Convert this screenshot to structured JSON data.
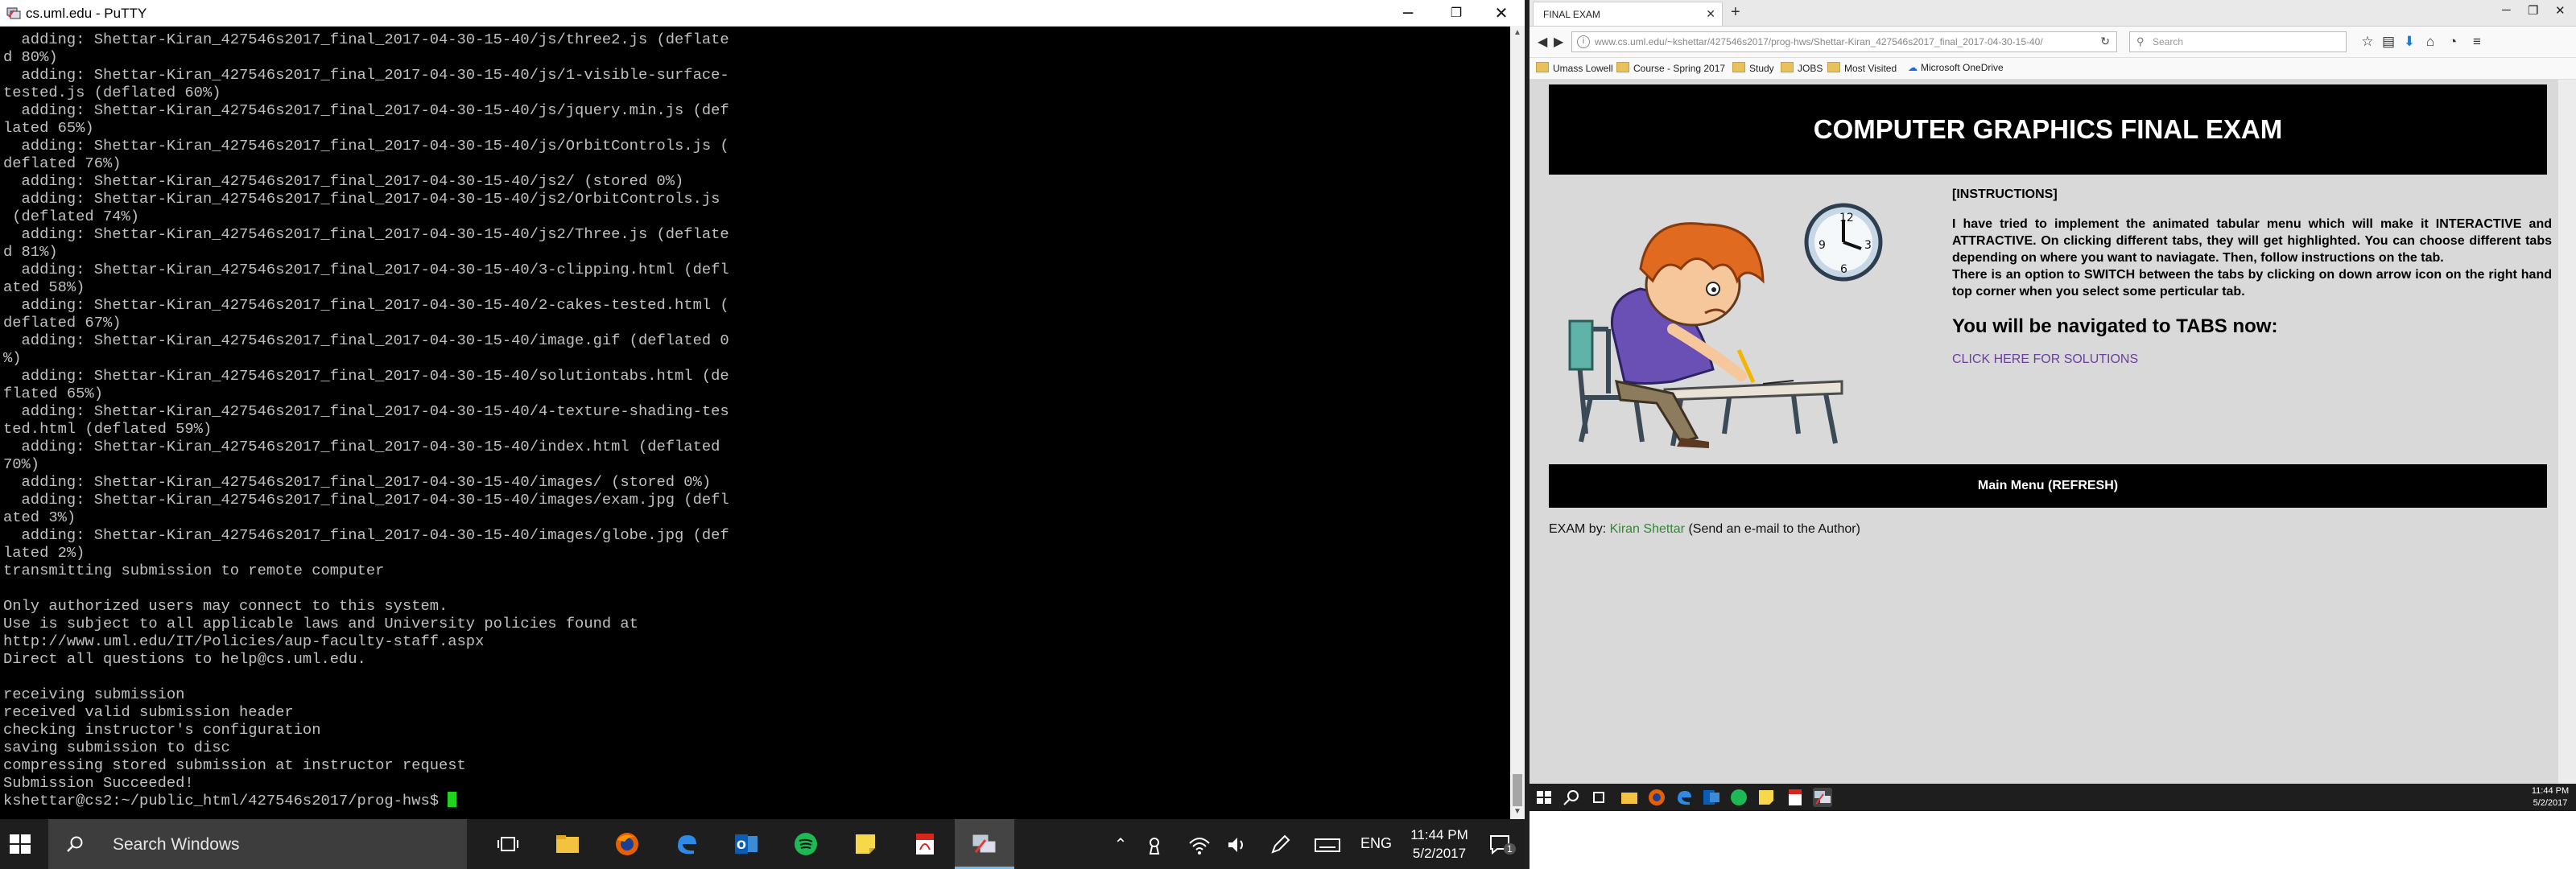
{
  "putty": {
    "title": "cs.uml.edu - PuTTY",
    "controls": {
      "minimize": "─",
      "restore": "❐",
      "close": "✕"
    },
    "terminal_lines": [
      "  adding: Shettar-Kiran_427546s2017_final_2017-04-30-15-40/js/three2.js (deflate",
      "d 80%)",
      "  adding: Shettar-Kiran_427546s2017_final_2017-04-30-15-40/js/1-visible-surface-",
      "tested.js (deflated 60%)",
      "  adding: Shettar-Kiran_427546s2017_final_2017-04-30-15-40/js/jquery.min.js (def",
      "lated 65%)",
      "  adding: Shettar-Kiran_427546s2017_final_2017-04-30-15-40/js/OrbitControls.js (",
      "deflated 76%)",
      "  adding: Shettar-Kiran_427546s2017_final_2017-04-30-15-40/js2/ (stored 0%)",
      "  adding: Shettar-Kiran_427546s2017_final_2017-04-30-15-40/js2/OrbitControls.js",
      " (deflated 74%)",
      "  adding: Shettar-Kiran_427546s2017_final_2017-04-30-15-40/js2/Three.js (deflate",
      "d 81%)",
      "  adding: Shettar-Kiran_427546s2017_final_2017-04-30-15-40/3-clipping.html (defl",
      "ated 58%)",
      "  adding: Shettar-Kiran_427546s2017_final_2017-04-30-15-40/2-cakes-tested.html (",
      "deflated 67%)",
      "  adding: Shettar-Kiran_427546s2017_final_2017-04-30-15-40/image.gif (deflated 0",
      "%)",
      "  adding: Shettar-Kiran_427546s2017_final_2017-04-30-15-40/solutiontabs.html (de",
      "flated 65%)",
      "  adding: Shettar-Kiran_427546s2017_final_2017-04-30-15-40/4-texture-shading-tes",
      "ted.html (deflated 59%)",
      "  adding: Shettar-Kiran_427546s2017_final_2017-04-30-15-40/index.html (deflated",
      "70%)",
      "  adding: Shettar-Kiran_427546s2017_final_2017-04-30-15-40/images/ (stored 0%)",
      "  adding: Shettar-Kiran_427546s2017_final_2017-04-30-15-40/images/exam.jpg (defl",
      "ated 3%)",
      "  adding: Shettar-Kiran_427546s2017_final_2017-04-30-15-40/images/globe.jpg (def",
      "lated 2%)",
      "transmitting submission to remote computer",
      "",
      "Only authorized users may connect to this system.",
      "Use is subject to all applicable laws and University policies found at",
      "http://www.uml.edu/IT/Policies/aup-faculty-staff.aspx",
      "Direct all questions to help@cs.uml.edu.",
      "",
      "receiving submission",
      "received valid submission header",
      "checking instructor's configuration",
      "saving submission to disc",
      "compressing stored submission at instructor request",
      "Submission Succeeded!"
    ],
    "prompt": "kshettar@cs2:~/public_html/427546s2017/prog-hws$ "
  },
  "taskbar_left": {
    "search_placeholder": "Search Windows",
    "language": "ENG",
    "time": "11:44 PM",
    "date": "5/2/2017",
    "notification_count": "1"
  },
  "firefox": {
    "tab_title": "FINAL EXAM",
    "url": "www.cs.uml.edu/~kshettar/427546s2017/prog-hws/Shettar-Kiran_427546s2017_final_2017-04-30-15-40/",
    "search_placeholder": "Search",
    "bookmarks": [
      "Umass Lowell",
      "Course - Spring 2017",
      "Study",
      "JOBS",
      "Most Visited",
      "Microsoft OneDrive"
    ]
  },
  "page": {
    "header": "COMPUTER GRAPHICS FINAL EXAM",
    "instructions_heading": "[INSTRUCTIONS]",
    "instructions_p1": "I have tried to implement the animated tabular menu which will make it INTERACTIVE and ATTRACTIVE. On clicking different tabs, they will get highlighted. You can choose different tabs depending on where you want to naviagate. Then, follow instructions on the tab.",
    "instructions_p2": "There is an option to SWITCH between the tabs by clicking on down arrow icon on the right hand top corner when you select some perticular tab.",
    "tabs_now": "You will be navigated to TABS now:",
    "solutions_link": "CLICK HERE FOR SOLUTIONS",
    "main_menu": "Main Menu (REFRESH)",
    "footer_prefix": "EXAM by:",
    "footer_author": "Kiran Shettar",
    "footer_suffix": "(Send an e-mail to the Author)"
  },
  "taskbar_right": {
    "time": "11:44 PM",
    "date": "5/2/2017"
  }
}
